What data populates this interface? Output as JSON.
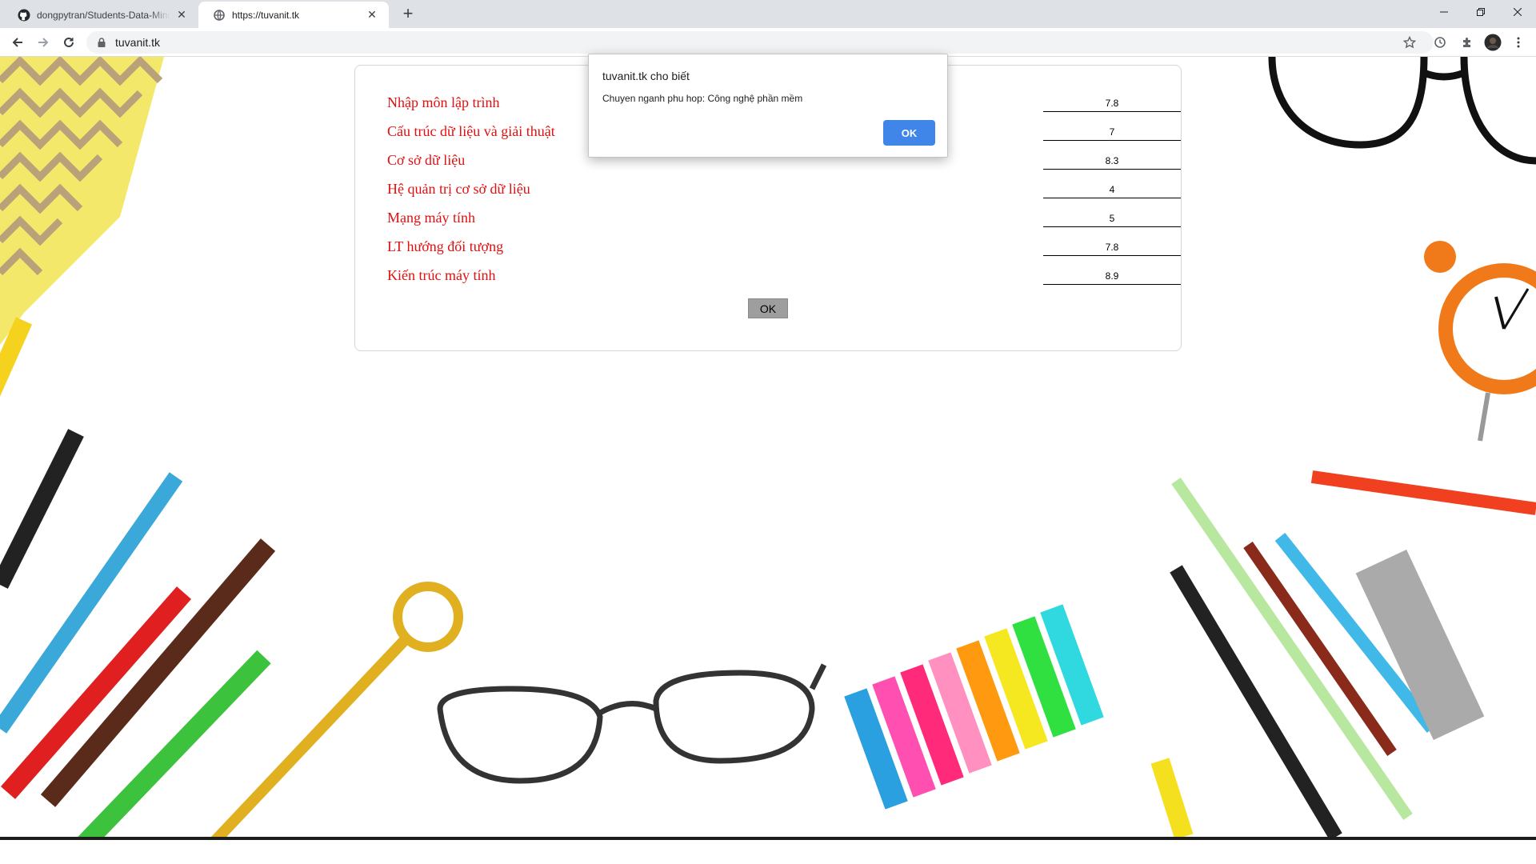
{
  "browser": {
    "tabs": [
      {
        "title": "dongpytran/Students-Data-Minin",
        "icon": "github-icon"
      },
      {
        "title": "https://tuvanit.tk",
        "icon": "globe-icon"
      }
    ],
    "url": "tuvanit.tk"
  },
  "form": {
    "subjects": [
      {
        "label": "Nhập môn lập trình",
        "score": "7.8"
      },
      {
        "label": "Cấu trúc dữ liệu và giải thuật",
        "score": "7"
      },
      {
        "label": "Cơ sở dữ liệu",
        "score": "8.3"
      },
      {
        "label": "Hệ quản trị cơ sở dữ liệu",
        "score": "4"
      },
      {
        "label": "Mạng máy tính",
        "score": "5"
      },
      {
        "label": "LT hướng đối tượng",
        "score": "7.8"
      },
      {
        "label": "Kiến trúc máy tính",
        "score": "8.9"
      }
    ],
    "submit_label": "OK"
  },
  "alert": {
    "title": "tuvanit.tk cho biết",
    "message": "Chuyen nganh phu hop: Công nghệ phần mềm",
    "ok_label": "OK"
  },
  "colors": {
    "subject_text": "#e01010",
    "alert_button": "#3f86e8",
    "tabstrip": "#dee1e6"
  }
}
